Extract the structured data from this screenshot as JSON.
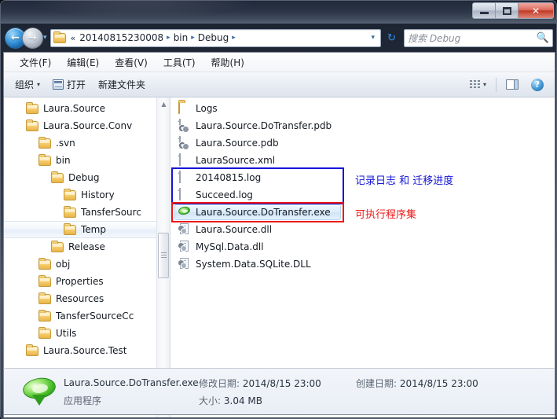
{
  "window": {
    "controls": {
      "minimize": "minimize-button",
      "maximize": "restore-button",
      "close_label": "✕"
    }
  },
  "nav": {
    "back_arrow": "←",
    "forward_arrow": "→",
    "history_caret": "▾",
    "breadcrumb_chev": "«",
    "crumbs": [
      "20140815230008",
      "bin",
      "Debug"
    ],
    "crumb_sep": "▸",
    "address_dropdown": "▾",
    "refresh": "↻"
  },
  "search": {
    "placeholder": "搜索 Debug",
    "icon": "🔍"
  },
  "menu": [
    {
      "label": "文件(F)"
    },
    {
      "label": "编辑(E)"
    },
    {
      "label": "查看(V)"
    },
    {
      "label": "工具(T)"
    },
    {
      "label": "帮助(H)"
    }
  ],
  "toolbar": {
    "organize_label": "组织",
    "organize_caret": "▾",
    "open_label": "打开",
    "new_folder_label": "新建文件夹",
    "views_caret": "▾"
  },
  "tree": {
    "items": [
      {
        "label": "Laura.Source",
        "indent": 1,
        "hover": false
      },
      {
        "label": "Laura.Source.Conv",
        "indent": 1,
        "hover": false
      },
      {
        "label": ".svn",
        "indent": 2,
        "hover": false
      },
      {
        "label": "bin",
        "indent": 2,
        "hover": false
      },
      {
        "label": "Debug",
        "indent": 3,
        "hover": false
      },
      {
        "label": "History",
        "indent": 4,
        "hover": false
      },
      {
        "label": "TansferSourc",
        "indent": 4,
        "hover": false
      },
      {
        "label": "Temp",
        "indent": 4,
        "hover": true
      },
      {
        "label": "Release",
        "indent": 3,
        "hover": false
      },
      {
        "label": "obj",
        "indent": 2,
        "hover": false
      },
      {
        "label": "Properties",
        "indent": 2,
        "hover": false
      },
      {
        "label": "Resources",
        "indent": 2,
        "hover": false
      },
      {
        "label": "TansferSourceCc",
        "indent": 2,
        "hover": false
      },
      {
        "label": "Utils",
        "indent": 2,
        "hover": false
      },
      {
        "label": "Laura.Source.Test",
        "indent": 1,
        "hover": false
      }
    ],
    "scroll_up": "▲",
    "scroll_down": "▼"
  },
  "files": {
    "items": [
      {
        "name": "Logs",
        "icon": "folder",
        "selected": false
      },
      {
        "name": "Laura.Source.DoTransfer.pdb",
        "icon": "pdb",
        "selected": false
      },
      {
        "name": "Laura.Source.pdb",
        "icon": "pdb",
        "selected": false
      },
      {
        "name": "LauraSource.xml",
        "icon": "xml",
        "selected": false
      },
      {
        "name": "20140815.log",
        "icon": "log",
        "selected": false
      },
      {
        "name": "Succeed.log",
        "icon": "log",
        "selected": false
      },
      {
        "name": "Laura.Source.DoTransfer.exe",
        "icon": "exe",
        "selected": true
      },
      {
        "name": "Laura.Source.dll",
        "icon": "dll",
        "selected": false
      },
      {
        "name": "MySql.Data.dll",
        "icon": "dll",
        "selected": false
      },
      {
        "name": "System.Data.SQLite.DLL",
        "icon": "dll",
        "selected": false
      }
    ]
  },
  "annotations": {
    "blue_text": "记录日志 和 迁移进度",
    "blue_color": "#1414d8",
    "red_text": "可执行程序集",
    "red_color": "#ee1515"
  },
  "status": {
    "filename": "Laura.Source.DoTransfer.exe",
    "filetype": "应用程序",
    "modified_label": "修改日期:",
    "modified_value": "2014/8/15 23:00",
    "created_label": "创建日期:",
    "created_value": "2014/8/15 23:00",
    "size_label": "大小:",
    "size_value": "3.04 MB"
  }
}
